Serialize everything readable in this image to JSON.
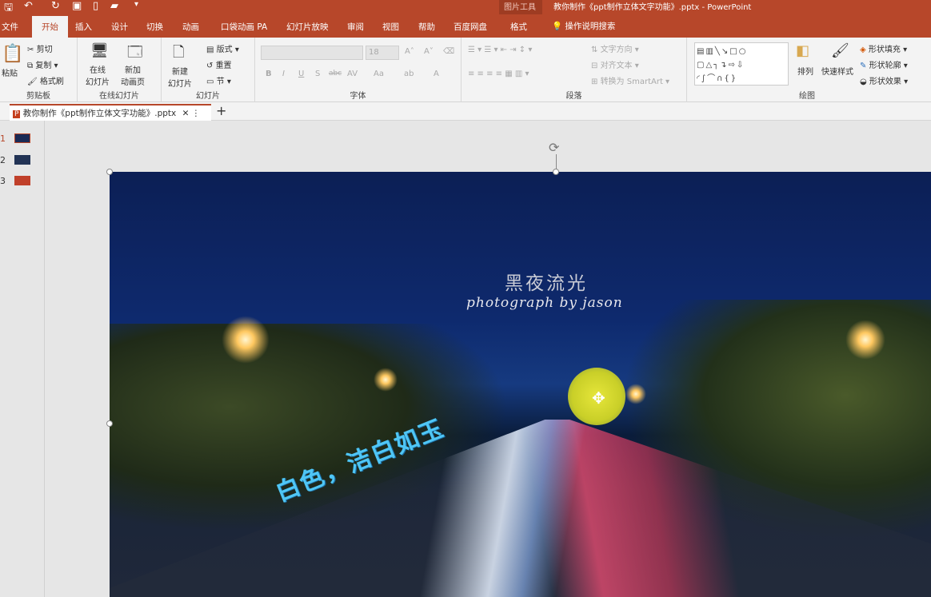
{
  "titlebar": {
    "context_label": "图片工具",
    "title": "教你制作《ppt制作立体文字功能》.pptx  -  PowerPoint"
  },
  "tabs": [
    {
      "label": "文件"
    },
    {
      "label": "开始"
    },
    {
      "label": "插入"
    },
    {
      "label": "设计"
    },
    {
      "label": "切换"
    },
    {
      "label": "动画"
    },
    {
      "label": "口袋动画 PA"
    },
    {
      "label": "幻灯片放映"
    },
    {
      "label": "审阅"
    },
    {
      "label": "视图"
    },
    {
      "label": "帮助"
    },
    {
      "label": "百度网盘"
    },
    {
      "label": "格式"
    }
  ],
  "tell_me": "操作说明搜索",
  "ribbon": {
    "clipboard": {
      "label": "剪贴板",
      "paste": "粘贴",
      "cut": "剪切",
      "copy": "复制",
      "format_painter": "格式刷"
    },
    "online": {
      "label": "在线幻灯片",
      "online_slides": "在线\n幻灯片",
      "new_anim": "新加\n动画页"
    },
    "slides": {
      "label": "幻灯片",
      "new_slide": "新建\n幻灯片",
      "layout": "版式",
      "reset": "重置",
      "section": "节"
    },
    "font": {
      "label": "字体",
      "font_name": "",
      "font_size": "18",
      "bold": "B",
      "italic": "I",
      "underline": "U",
      "shadow": "S",
      "strike": "abc",
      "spacing": "AV",
      "case": "Aa",
      "color": "A"
    },
    "paragraph": {
      "label": "段落",
      "text_direction": "文字方向",
      "align_text": "对齐文本",
      "smartart": "转换为 SmartArt"
    },
    "drawing": {
      "label": "绘图",
      "arrange": "排列",
      "quick_styles": "快速样式",
      "shape_fill": "形状填充",
      "shape_outline": "形状轮廓",
      "shape_effects": "形状效果"
    }
  },
  "document_tab": {
    "name": "教你制作《ppt制作立体文字功能》.pptx"
  },
  "slides": [
    {
      "number": "1"
    },
    {
      "number": "2"
    },
    {
      "number": "3"
    }
  ],
  "slide": {
    "title": "黑夜流光",
    "subtitle": "photograph by jason",
    "wordart": "白色，洁白如玉"
  },
  "colors": {
    "accent": "#b7472a"
  }
}
